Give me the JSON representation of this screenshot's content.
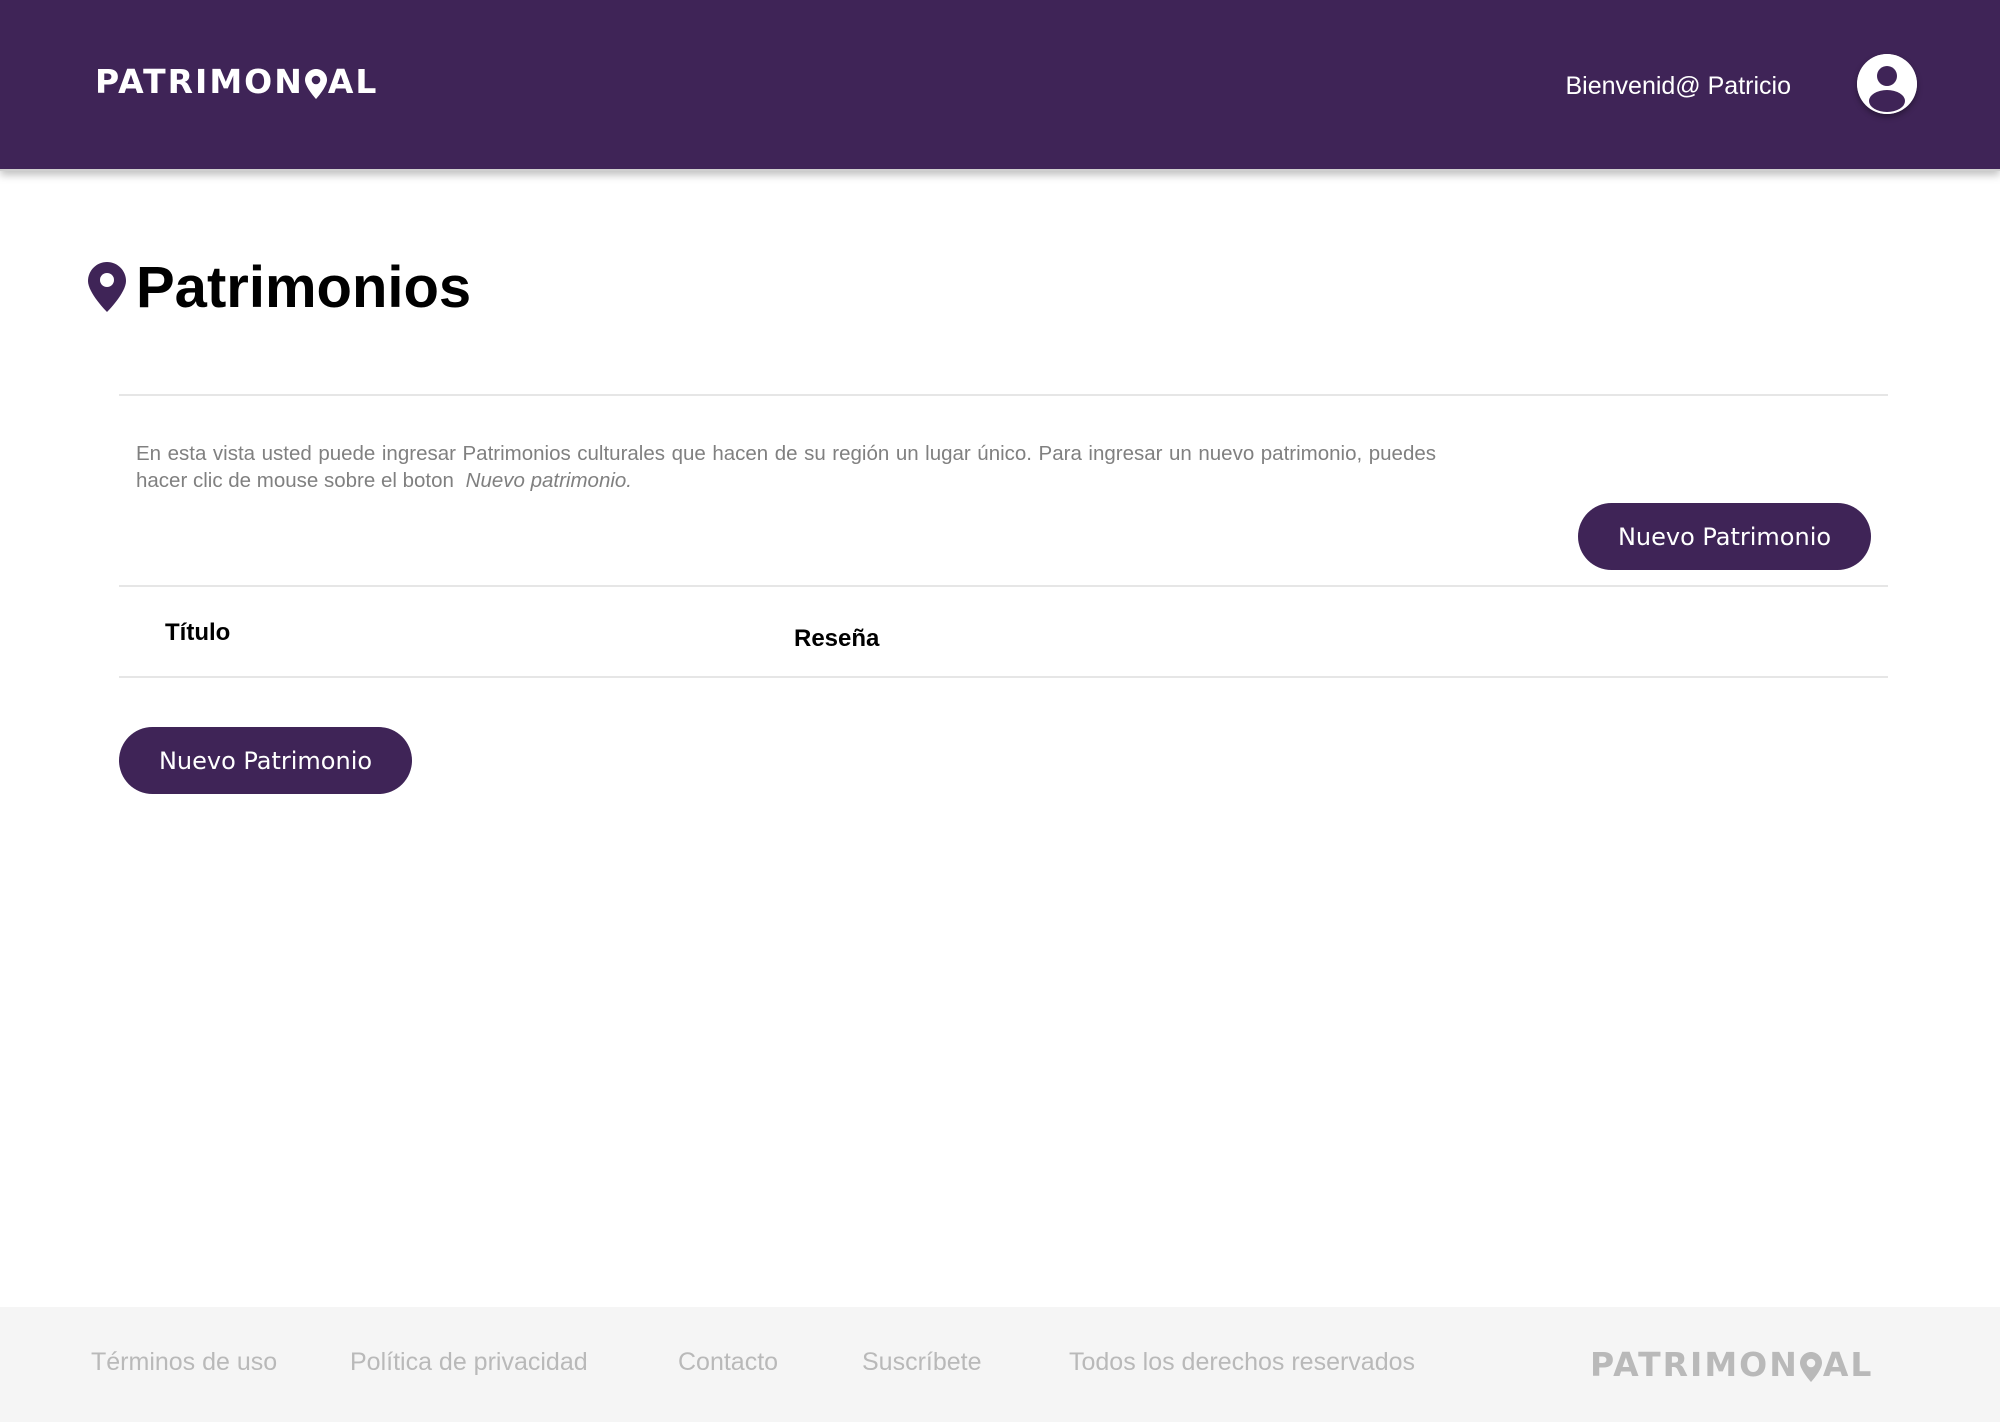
{
  "header": {
    "logo_part1": "PATRIMON",
    "logo_part2": "AL",
    "welcome": "Bienvenid@ Patricio",
    "background_color": "#3f2457"
  },
  "page": {
    "title": "Patrimonios",
    "title_icon": "map-pin-icon",
    "description_text": "En esta vista usted puede ingresar Patrimonios culturales que hacen de su región un lugar único. Para ingresar un nuevo patrimonio, puedes hacer clic de mouse sobre el boton",
    "description_emphasis": "Nuevo patrimonio."
  },
  "actions": {
    "new_button_top": "Nuevo Patrimonio",
    "new_button_bottom": "Nuevo Patrimonio",
    "accent_color": "#3f2457"
  },
  "table": {
    "columns": [
      "Título",
      "Reseña"
    ],
    "rows": []
  },
  "footer": {
    "links": [
      "Términos de uso",
      "Política de privacidad",
      "Contacto",
      "Suscríbete",
      "Todos los derechos reservados"
    ],
    "logo_part1": "PATRIMON",
    "logo_part2": "AL",
    "text_color": "#b9b9b9"
  }
}
